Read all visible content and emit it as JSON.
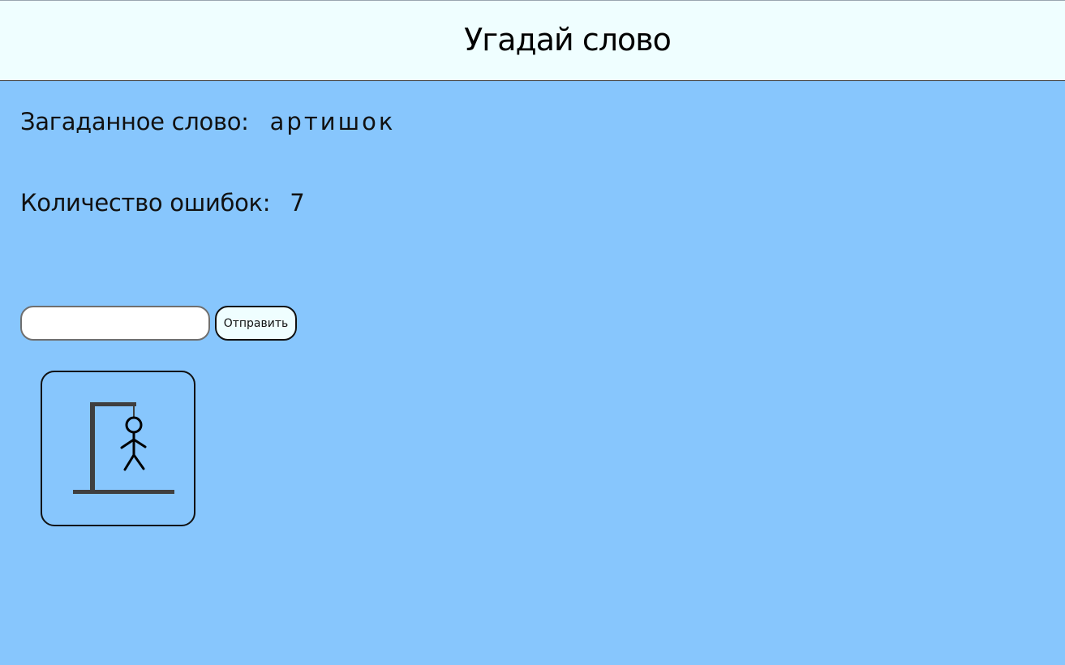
{
  "header": {
    "title": "Угадай слово"
  },
  "game": {
    "word_label": "Загаданное слово:",
    "word_value": "артишок",
    "errors_label": "Количество ошибок:",
    "errors_value": "7"
  },
  "form": {
    "input_value": "",
    "submit_label": "Отправить"
  },
  "hangman": {
    "icon": "hangman-gallows-icon",
    "mistakes_shown": 7
  },
  "colors": {
    "background": "#87c6fd",
    "header_background": "#effeff",
    "gallows": "#3f3f3f",
    "figure": "#000000"
  }
}
